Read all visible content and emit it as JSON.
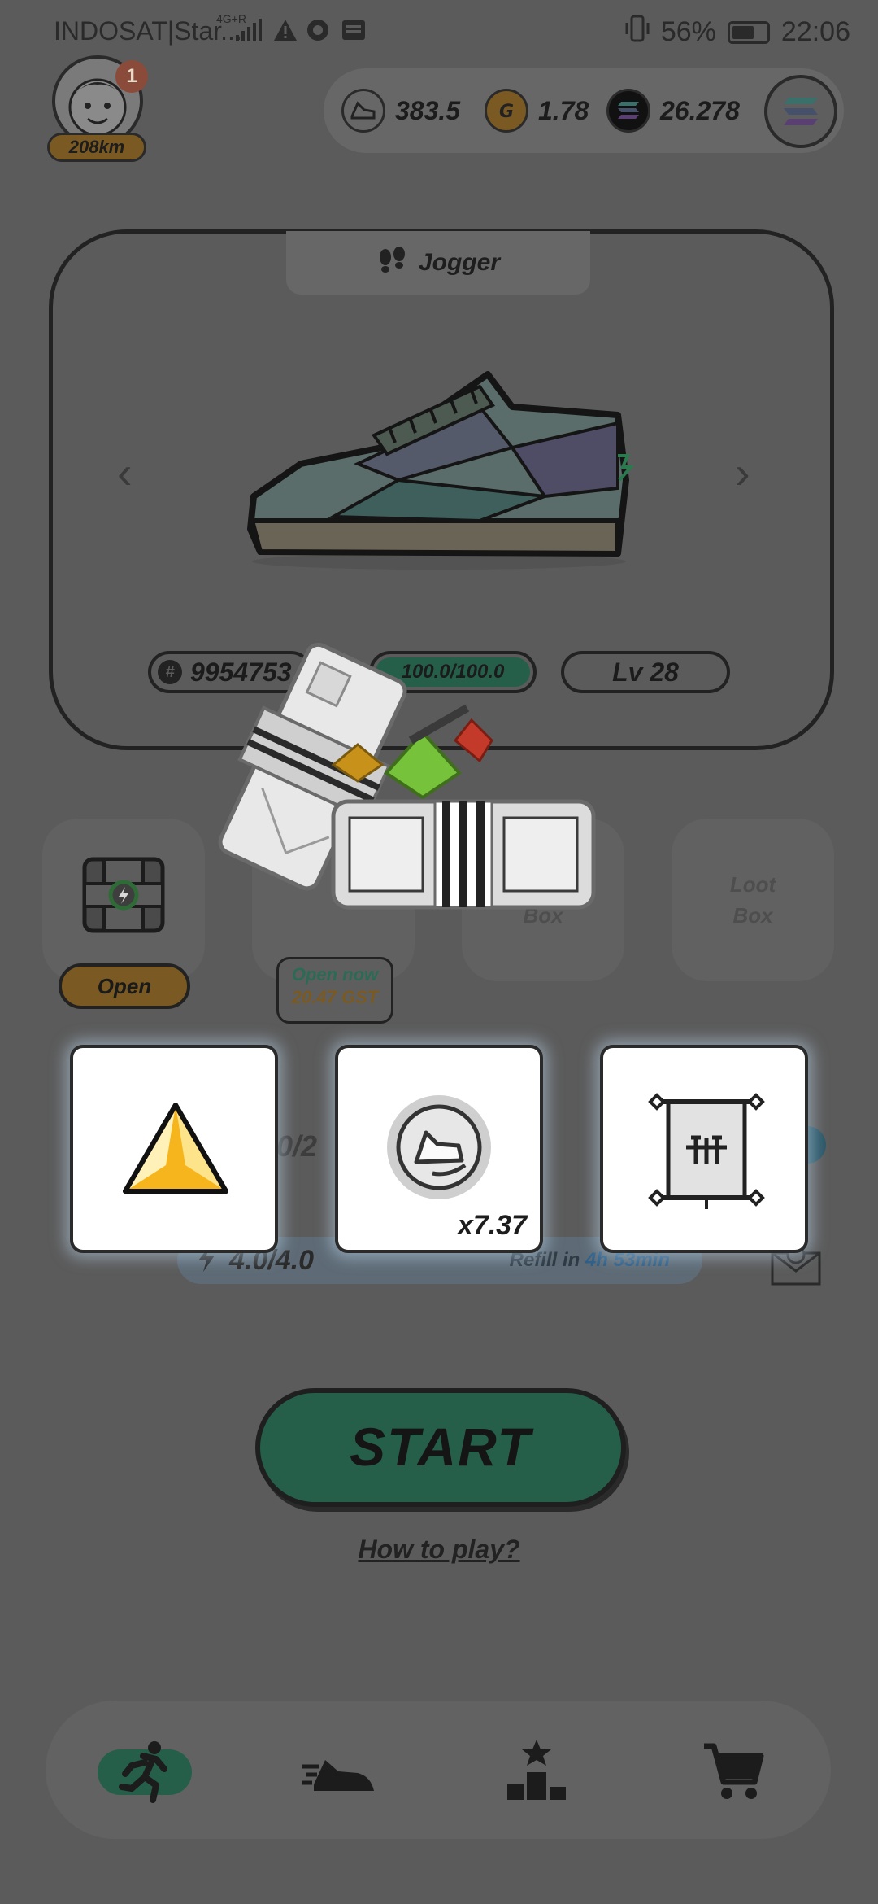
{
  "status_bar": {
    "carrier": "INDOSAT|Star...",
    "network": "4G+R",
    "battery_percent": "56%",
    "time": "22:06"
  },
  "profile": {
    "notification_count": "1",
    "distance": "208km"
  },
  "balances": [
    {
      "icon": "gmt-shoe-coin-icon",
      "value": "383.5"
    },
    {
      "icon": "gst-coin-icon",
      "value": "1.78"
    },
    {
      "icon": "solana-icon",
      "value": "26.278"
    }
  ],
  "sneaker": {
    "type_label": "Jogger",
    "id": "9954753",
    "durability": "100.0/100.0",
    "level": "Lv 28"
  },
  "boxes": {
    "slot1_button": "Open",
    "slot2_open_now": "Open now",
    "slot2_cost": "20.47 GST",
    "slot3_label": "Box",
    "slot4_label_line1": "Loot",
    "slot4_label_line2": "Box"
  },
  "energy": {
    "progress_partial": "0/2",
    "value": "4.0/4.0",
    "refill_prefix": "Refill in ",
    "refill_time": "4h 53min"
  },
  "rewards": [
    {
      "icon": "yellow-gem-icon",
      "qty": ""
    },
    {
      "icon": "gst-token-icon",
      "qty": "x7.37"
    },
    {
      "icon": "scroll-icon",
      "qty": ""
    }
  ],
  "start_button": "START",
  "how_to_play": "How to play?",
  "colors": {
    "overlay": "#5b5b5b",
    "accent_green": "#255f4a",
    "gold": "#7a5a22",
    "gem_yellow": "#f7b51d"
  }
}
